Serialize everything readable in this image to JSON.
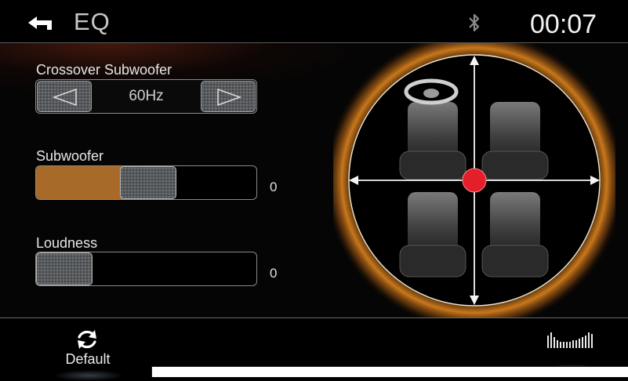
{
  "header": {
    "title": "EQ",
    "clock": "00:07",
    "back_icon": "back-arrow-icon",
    "status_icon": "bluetooth-icon"
  },
  "crossover": {
    "label": "Crossover Subwoofer",
    "value": "60Hz",
    "prev_icon": "triangle-left-icon",
    "next_icon": "triangle-right-icon"
  },
  "subwoofer": {
    "label": "Subwoofer",
    "value": "0",
    "fill_fraction": 0.38
  },
  "loudness": {
    "label": "Loudness",
    "value": "0",
    "fill_fraction": 0.0
  },
  "balance": {
    "marker_color": "#e41e2a",
    "ring_glow_color": "#e0851e"
  },
  "footer": {
    "default_label": "Default",
    "default_icon": "refresh-icon",
    "eq_icon": "equalizer-bars-icon"
  },
  "colors": {
    "accent": "#a86a28",
    "background": "#000000"
  }
}
